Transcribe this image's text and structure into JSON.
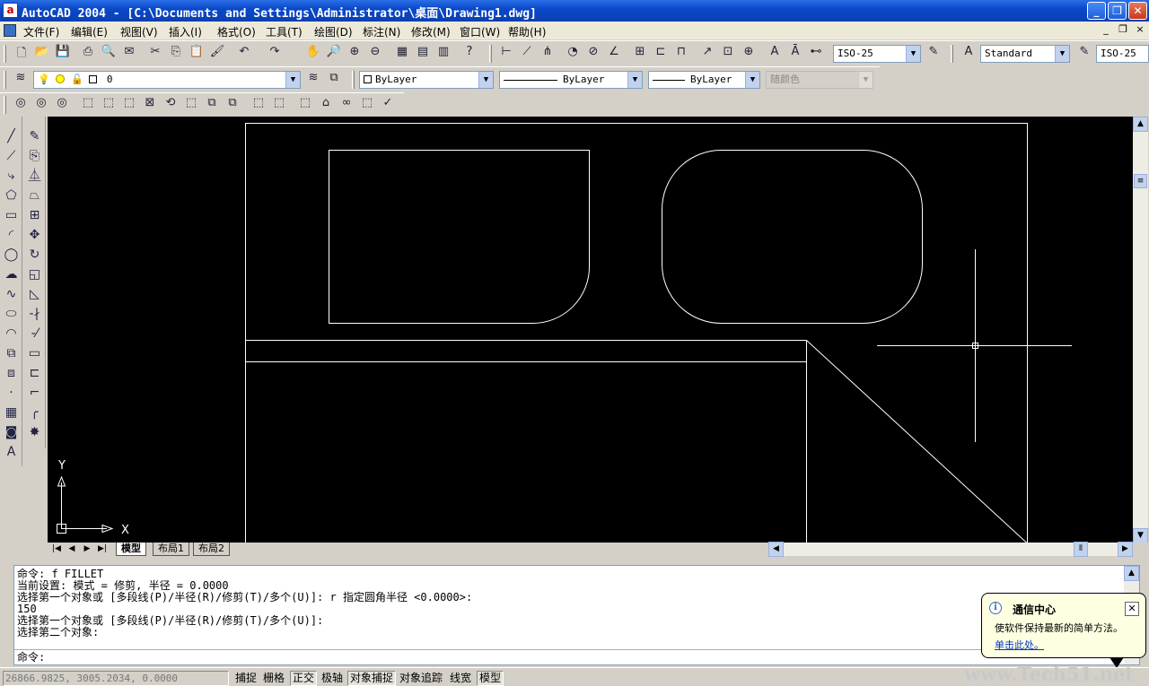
{
  "window": {
    "title": "AutoCAD 2004 - [C:\\Documents and Settings\\Administrator\\桌面\\Drawing1.dwg]",
    "app_icon": "a"
  },
  "window_controls": {
    "minimize": "_",
    "restore": "❐",
    "close": "✕"
  },
  "menu": [
    "文件(F)",
    "编辑(E)",
    "视图(V)",
    "插入(I)",
    "格式(O)",
    "工具(T)",
    "绘图(D)",
    "标注(N)",
    "修改(M)",
    "窗口(W)",
    "帮助(H)"
  ],
  "mdi_controls": {
    "minimize": "_",
    "restore": "❐",
    "close": "×"
  },
  "standard_toolbar": {
    "dimstyle": "ISO-25",
    "textstyle": "Standard",
    "tablestyle": "ISO-25"
  },
  "layers_toolbar": {
    "current_layer": "0"
  },
  "properties_toolbar": {
    "color": "ByLayer",
    "linetype": "ByLayer",
    "lineweight": "ByLayer",
    "plotstyle": "随颜色"
  },
  "ucs": {
    "x_label": "X",
    "y_label": "Y"
  },
  "layout_tabs": [
    "模型",
    "布局1",
    "布局2"
  ],
  "command_history": [
    "命令: f FILLET",
    "当前设置: 模式 = 修剪, 半径 = 0.0000",
    "选择第一个对象或 [多段线(P)/半径(R)/修剪(T)/多个(U)]: r 指定圆角半径 <0.0000>:",
    "150",
    "选择第一个对象或 [多段线(P)/半径(R)/修剪(T)/多个(U)]:",
    "选择第二个对象:"
  ],
  "command_prompt": "命令:",
  "balloon": {
    "title": "通信中心",
    "text": "使软件保持最新的简单方法。",
    "link": "单击此处。"
  },
  "status": {
    "coords": "26866.9825, 3005.2034, 0.0000",
    "modes": [
      {
        "label": "捕捉",
        "on": false
      },
      {
        "label": "栅格",
        "on": false
      },
      {
        "label": "正交",
        "on": true
      },
      {
        "label": "极轴",
        "on": false
      },
      {
        "label": "对象捕捉",
        "on": true
      },
      {
        "label": "对象追踪",
        "on": false
      },
      {
        "label": "线宽",
        "on": false
      },
      {
        "label": "模型",
        "on": true
      }
    ]
  },
  "watermark": "www.Tech51.net",
  "colors": {
    "titlebar": "#0a49c9",
    "canvas": "#000000",
    "drawing_lines": "#ffffff",
    "link": "#0033cc"
  }
}
